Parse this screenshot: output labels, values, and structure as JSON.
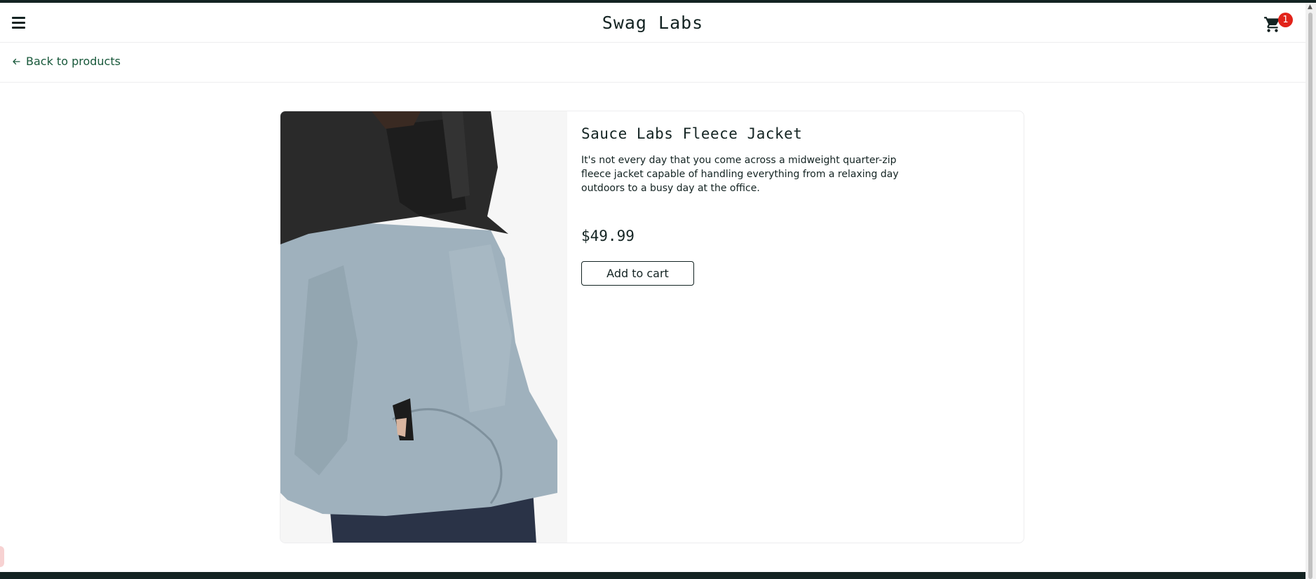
{
  "header": {
    "title": "Swag Labs",
    "menu_icon": "hamburger-menu-icon",
    "cart_icon": "shopping-cart-icon",
    "cart_count": "1"
  },
  "subheader": {
    "back_label": "Back to products",
    "back_icon": "arrow-left-icon"
  },
  "product": {
    "name": "Sauce Labs Fleece Jacket",
    "description": "It's not every day that you come across a midweight quarter-zip fleece jacket capable of handling everything from a relaxing day outdoors to a busy day at the office.",
    "price": "$49.99",
    "add_to_cart_label": "Add to cart",
    "image_alt": "Sauce Labs Fleece Jacket"
  },
  "colors": {
    "text": "#132322",
    "link": "#18583a",
    "badge": "#e2231a",
    "border": "#ededef"
  }
}
